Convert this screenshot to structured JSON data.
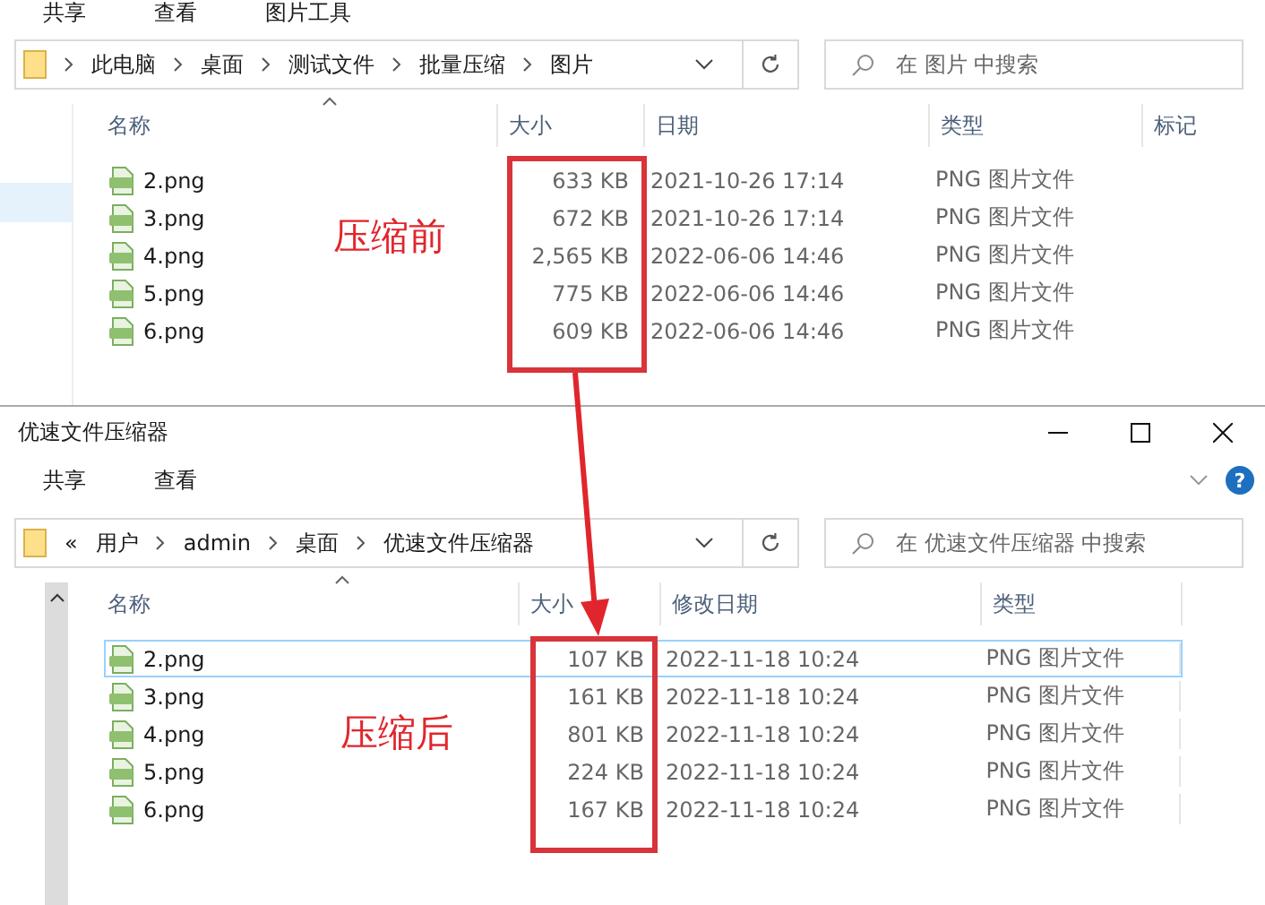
{
  "windows": [
    {
      "kind": "before",
      "ribbon_tabs": [
        "共享",
        "查看",
        "图片工具"
      ],
      "address": {
        "path": [
          "此电脑",
          "桌面",
          "测试文件",
          "批量压缩",
          "图片"
        ]
      },
      "search": {
        "placeholder": "在 图片 中搜索"
      },
      "columns": [
        "名称",
        "大小",
        "日期",
        "类型",
        "标记"
      ],
      "rows": [
        {
          "name": "2.png",
          "size": "633 KB",
          "date": "2021-10-26 17:14",
          "type": "PNG 图片文件",
          "selected": false
        },
        {
          "name": "3.png",
          "size": "672 KB",
          "date": "2021-10-26 17:14",
          "type": "PNG 图片文件",
          "selected": false
        },
        {
          "name": "4.png",
          "size": "2,565 KB",
          "date": "2022-06-06 14:46",
          "type": "PNG 图片文件",
          "selected": false
        },
        {
          "name": "5.png",
          "size": "775 KB",
          "date": "2022-06-06 14:46",
          "type": "PNG 图片文件",
          "selected": false
        },
        {
          "name": "6.png",
          "size": "609 KB",
          "date": "2022-06-06 14:46",
          "type": "PNG 图片文件",
          "selected": false
        }
      ],
      "annotation": "压缩前"
    },
    {
      "kind": "after",
      "title": "优速文件压缩器",
      "help": "?",
      "ribbon_tabs": [
        "共享",
        "查看"
      ],
      "address": {
        "overflow": "«",
        "path": [
          "用户",
          "admin",
          "桌面",
          "优速文件压缩器"
        ]
      },
      "search": {
        "placeholder": "在 优速文件压缩器 中搜索"
      },
      "columns": [
        "名称",
        "大小",
        "修改日期",
        "类型"
      ],
      "rows": [
        {
          "name": "2.png",
          "size": "107 KB",
          "date": "2022-11-18 10:24",
          "type": "PNG 图片文件",
          "selected": true
        },
        {
          "name": "3.png",
          "size": "161 KB",
          "date": "2022-11-18 10:24",
          "type": "PNG 图片文件",
          "selected": false
        },
        {
          "name": "4.png",
          "size": "801 KB",
          "date": "2022-11-18 10:24",
          "type": "PNG 图片文件",
          "selected": false
        },
        {
          "name": "5.png",
          "size": "224 KB",
          "date": "2022-11-18 10:24",
          "type": "PNG 图片文件",
          "selected": false
        },
        {
          "name": "6.png",
          "size": "167 KB",
          "date": "2022-11-18 10:24",
          "type": "PNG 图片文件",
          "selected": false
        }
      ],
      "annotation": "压缩后"
    }
  ]
}
